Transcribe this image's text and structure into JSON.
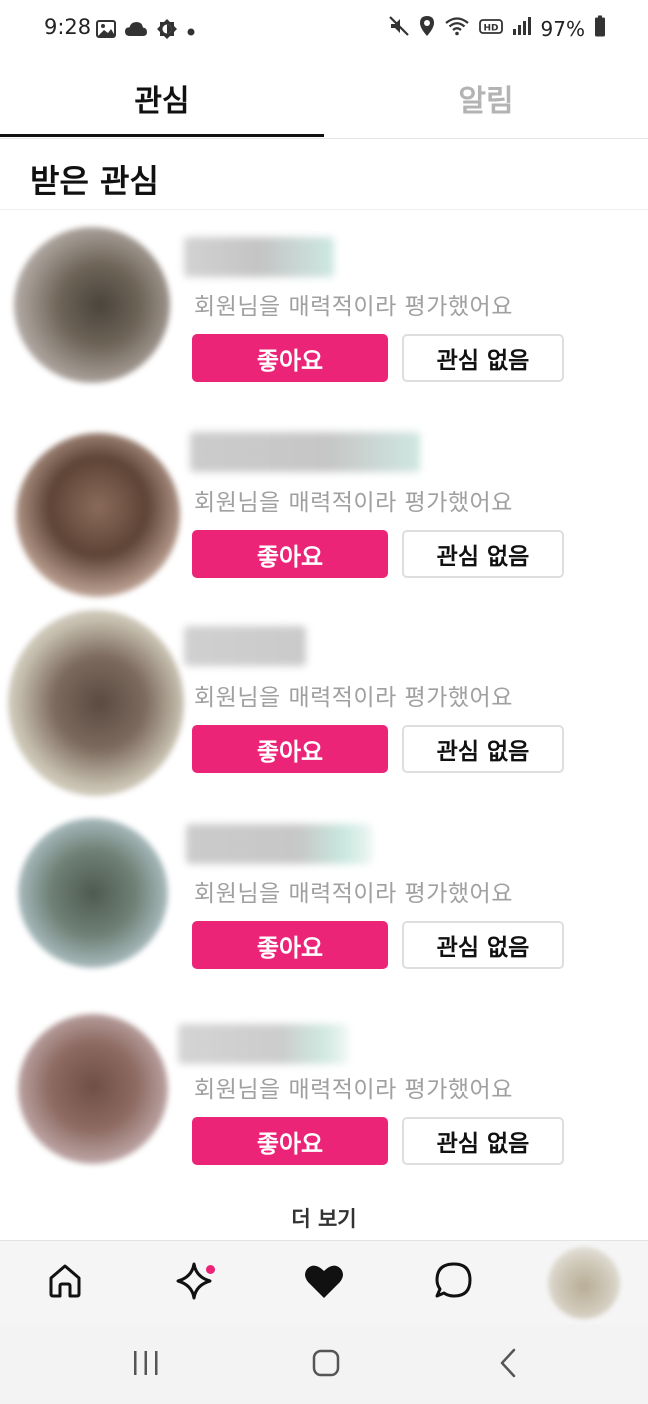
{
  "status_bar": {
    "time": "9:28",
    "battery": "97%",
    "left_icons": [
      "gallery-icon",
      "cloud-icon",
      "brightness-icon",
      "dot-icon"
    ],
    "right_icons": [
      "mute-icon",
      "location-icon",
      "wifi-icon",
      "hd-icon",
      "signal-icon",
      "battery-icon"
    ]
  },
  "tabs": [
    {
      "label": "관심",
      "active": true
    },
    {
      "label": "알림",
      "active": false
    }
  ],
  "section": {
    "title": "받은 관심"
  },
  "cards": [
    {
      "message": "회원님을 매력적이라 평가했어요",
      "like_label": "좋아요",
      "no_interest_label": "관심 없음"
    },
    {
      "message": "회원님을 매력적이라 평가했어요",
      "like_label": "좋아요",
      "no_interest_label": "관심 없음"
    },
    {
      "message": "회원님을 매력적이라 평가했어요",
      "like_label": "좋아요",
      "no_interest_label": "관심 없음"
    },
    {
      "message": "회원님을 매력적이라 평가했어요",
      "like_label": "좋아요",
      "no_interest_label": "관심 없음"
    },
    {
      "message": "회원님을 매력적이라 평가했어요",
      "like_label": "좋아요",
      "no_interest_label": "관심 없음"
    }
  ],
  "more": {
    "label": "더 보기"
  },
  "bottom_nav": {
    "items": [
      "home-icon",
      "sparkle-icon",
      "heart-icon",
      "chat-icon",
      "profile-avatar"
    ],
    "notification_dot_color": "#ec2478"
  },
  "system_nav": [
    "recents-icon",
    "home-button-icon",
    "back-icon"
  ],
  "colors": {
    "accent": "#ec2478",
    "muted_text": "#a0a0a0",
    "inactive_tab": "#b3b3b3"
  }
}
